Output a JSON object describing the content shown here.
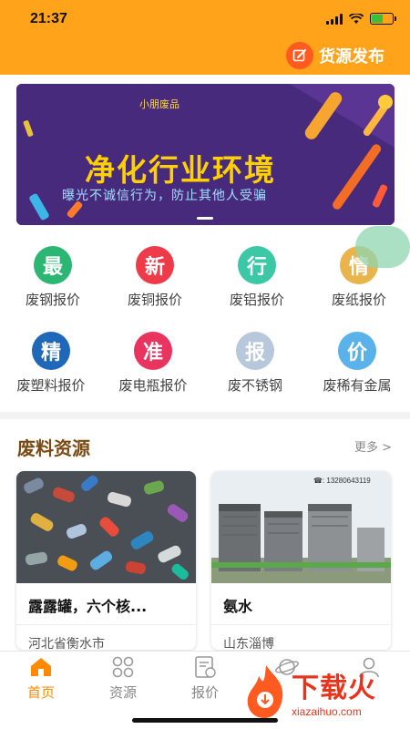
{
  "status_bar": {
    "time": "21:37"
  },
  "header": {
    "publish_label": "货源发布",
    "publish_icon": "edit-icon"
  },
  "banner": {
    "brand": "小朋废品",
    "title": "净化行业环境",
    "subtitle": "曝光不诚信行为，防止其他人受骗"
  },
  "categories": [
    {
      "char": "最",
      "label": "废钢报价",
      "color": "#2bb673"
    },
    {
      "char": "新",
      "label": "废铜报价",
      "color": "#ee3b4a"
    },
    {
      "char": "行",
      "label": "废铝报价",
      "color": "#3cc8a6"
    },
    {
      "char": "情",
      "label": "废纸报价",
      "color": "#e9b44c"
    },
    {
      "char": "精",
      "label": "废塑料报价",
      "color": "#1f67b8"
    },
    {
      "char": "准",
      "label": "废电瓶报价",
      "color": "#e8345f"
    },
    {
      "char": "报",
      "label": "废不锈钢",
      "color": "#b7c7dc"
    },
    {
      "char": "价",
      "label": "废稀有金属",
      "color": "#59b3ea"
    }
  ],
  "section": {
    "title": "废料资源",
    "more": "更多 >"
  },
  "listings": [
    {
      "title": "露露罐，六个核...",
      "location": "河北省衡水市"
    },
    {
      "title": "氨水",
      "location": "山东淄博",
      "phone": "☎: 13280643119"
    }
  ],
  "tabs": [
    {
      "label": "首页",
      "icon": "home-icon",
      "active": true
    },
    {
      "label": "资源",
      "icon": "grid-icon",
      "active": false
    },
    {
      "label": "报价",
      "icon": "quote-icon",
      "active": false
    },
    {
      "label": "",
      "icon": "planet-icon",
      "active": false
    },
    {
      "label": "",
      "icon": "user-icon",
      "active": false
    }
  ],
  "watermark": {
    "text": "下载火",
    "url": "xiazaihuo.com"
  },
  "colors": {
    "accent": "#ffa31a",
    "active_tab": "#ff8a00",
    "section_title": "#7a4a12"
  }
}
